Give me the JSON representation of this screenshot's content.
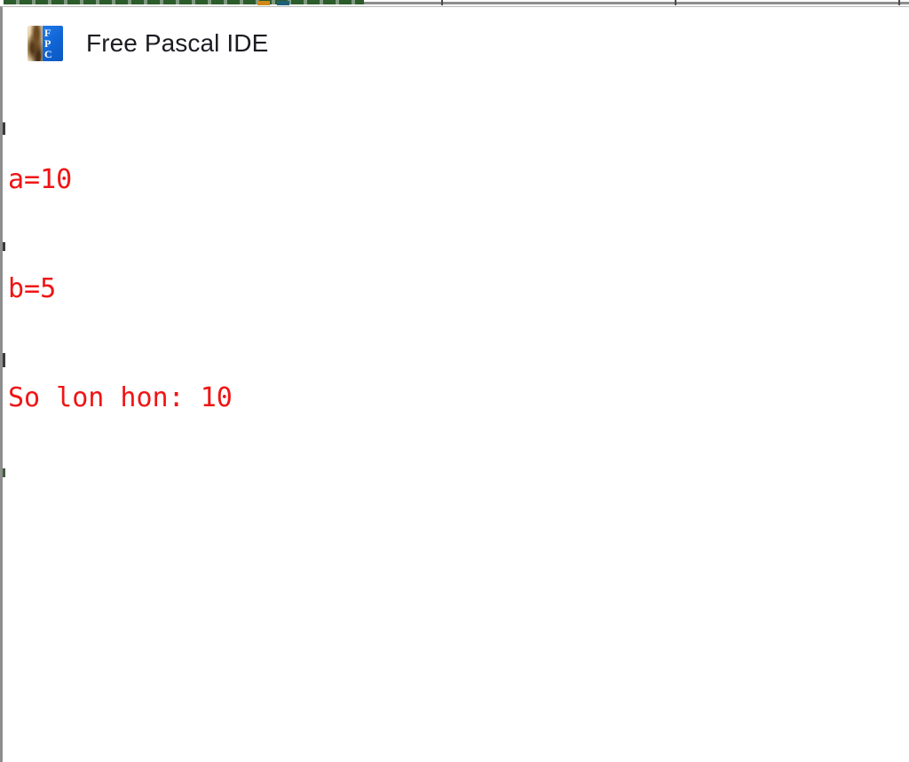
{
  "window": {
    "title": "Free Pascal IDE",
    "icon_name": "free-pascal-logo-icon",
    "icon_letters": [
      "F",
      "P",
      "C"
    ]
  },
  "console": {
    "text_color": "#f01414",
    "background_color": "#ffffff",
    "lines": [
      "a=10",
      "b=5",
      "So lon hon: 10"
    ]
  },
  "variables": {
    "a": "10",
    "b": "5",
    "result_label": "So lon hon",
    "result_value": "10"
  },
  "background_strip": {
    "dash_color": "#2c5c2c",
    "swatch_orange": "#d08a1a",
    "swatch_teal": "#1f5f78",
    "rule_color": "#8d8d8d"
  }
}
